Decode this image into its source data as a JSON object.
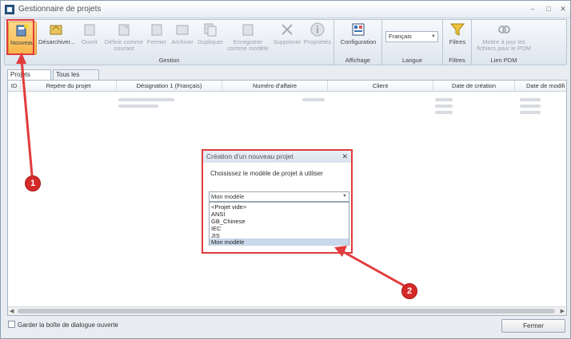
{
  "window": {
    "title": "Gestionnaire de projets"
  },
  "ribbon": {
    "gestion": {
      "label": "Gestion",
      "buttons": {
        "nouveau": "Nouveau",
        "desarchiver": "Désarchiver...",
        "ouvrir": "Ouvrir",
        "definir": "Définir comme courant",
        "fermer": "Fermer",
        "archiver": "Archiver",
        "dupliquer": "Dupliquer",
        "enregistrer": "Enregistrer comme modèle",
        "supprimer": "Supprimer",
        "proprietes": "Propriétés"
      }
    },
    "affichage": {
      "label": "Affichage",
      "configuration": "Configuration"
    },
    "langue": {
      "label": "Langue",
      "value": "Français"
    },
    "filtres": {
      "label": "Filtres",
      "button": "Filtres"
    },
    "pdm": {
      "label": "Lien PDM",
      "button": "Mettre à jour les fichiers pour le PDM"
    }
  },
  "tabs": [
    "Projets récents",
    "Tous les projets"
  ],
  "grid": {
    "columns": [
      "ID",
      "Repère du projet",
      "Désignation 1 (Français)",
      "Numéro d'affaire",
      "Client",
      "Date de création",
      "Date de modifi"
    ]
  },
  "footer": {
    "keep_open": "Garder la boîte de dialogue ouverte",
    "close": "Fermer"
  },
  "dialog": {
    "title": "Création d'un nouveau projet",
    "prompt": "Choisissez le modèle de projet à utiliser",
    "selected": "Mon modèle",
    "options": [
      "<Projet vide>",
      "ANSI",
      "GB_Chinese",
      "IEC",
      "JIS",
      "Mon modèle"
    ]
  },
  "callouts": [
    "1",
    "2"
  ],
  "colors": {
    "annotation": "#e23b3b",
    "ribbon_active": "#f5b44a",
    "selection": "#c9d8ea"
  }
}
